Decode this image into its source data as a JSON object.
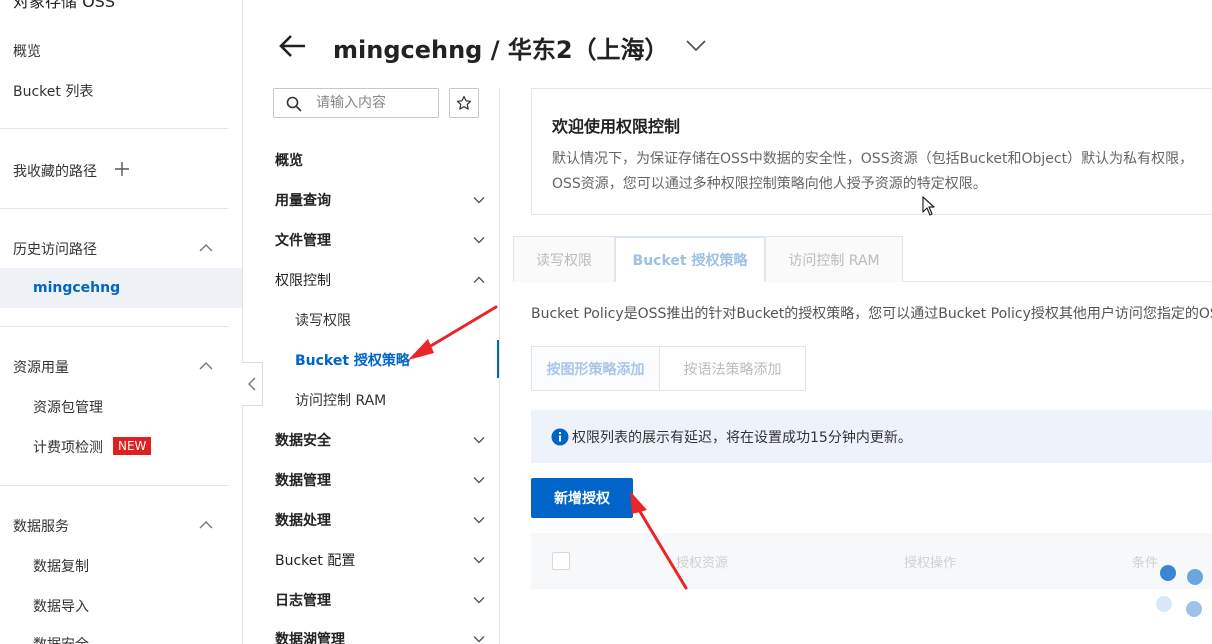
{
  "sidebar": {
    "app_title": "对象存储 OSS",
    "overview": "概览",
    "bucket_list": "Bucket 列表",
    "favorites": "我收藏的路径",
    "history": "历史访问路径",
    "history_active": "mingcehng",
    "resources": "资源用量",
    "resource_pkg": "资源包管理",
    "billing_check": "计费项检测",
    "new_badge": "NEW",
    "data_services": "数据服务",
    "data_replication": "数据复制",
    "data_import": "数据导入",
    "data_security": "数据安全"
  },
  "header": {
    "title": "mingcehng / 华东2（上海）"
  },
  "menu": {
    "search_placeholder": "请输入内容",
    "items": [
      {
        "label": "概览"
      },
      {
        "label": "用量查询"
      },
      {
        "label": "文件管理"
      },
      {
        "label": "权限控制"
      },
      {
        "label": "数据安全"
      },
      {
        "label": "数据管理"
      },
      {
        "label": "数据处理"
      },
      {
        "label": "Bucket 配置"
      },
      {
        "label": "日志管理"
      },
      {
        "label": "数据湖管理"
      }
    ],
    "sub_items": [
      {
        "label": "读写权限"
      },
      {
        "label": "Bucket 授权策略"
      },
      {
        "label": "访问控制 RAM"
      }
    ]
  },
  "welcome": {
    "title": "欢迎使用权限控制",
    "desc": "默认情况下，为保证存储在OSS中数据的安全性，OSS资源（包括Bucket和Object）默认为私有权限，OSS资源，您可以通过多种权限控制策略向他人授予资源的特定权限。"
  },
  "tabs": [
    "读写权限",
    "Bucket 授权策略",
    "访问控制 RAM"
  ],
  "policy_desc": "Bucket Policy是OSS推出的针对Bucket的授权策略，您可以通过Bucket Policy授权其他用户访问您指定的OSS",
  "mode_buttons": [
    "按图形策略添加",
    "按语法策略添加"
  ],
  "notice": "权限列表的展示有延迟，将在设置成功15分钟内更新。",
  "add_button": "新增授权",
  "table_headers": [
    "授权资源",
    "授权操作",
    "条件"
  ],
  "colors": {
    "accent": "#0064c8",
    "annotation_arrow": "#e8262a",
    "badge": "#e02020"
  }
}
